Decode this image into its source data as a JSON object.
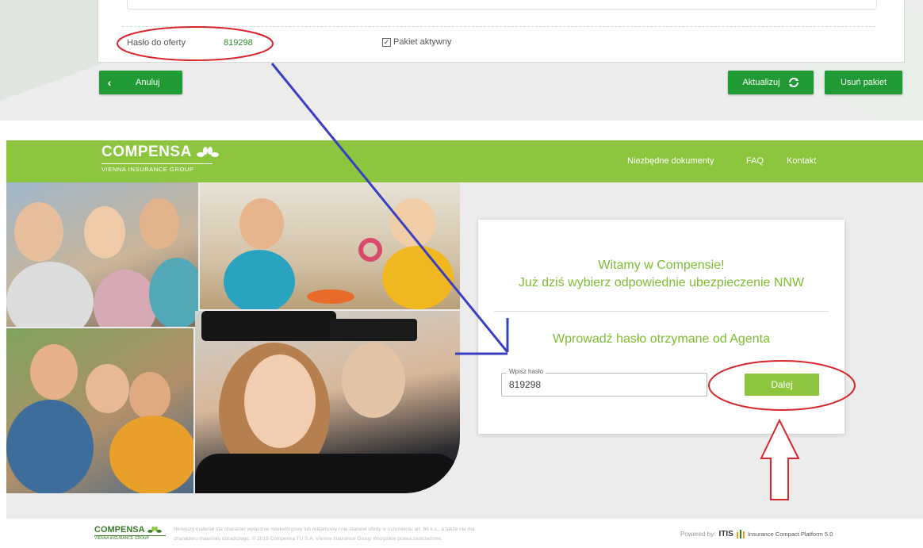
{
  "admin": {
    "password_label": "Hasło do oferty",
    "password_value": "819298",
    "package_active_label": "Pakiet aktywny",
    "package_active_checked": true,
    "cancel_label": "Anuluj",
    "update_label": "Aktualizuj",
    "delete_label": "Usuń pakiet"
  },
  "header": {
    "brand": "COMPENSA",
    "brand_sub": "VIENNA INSURANCE GROUP",
    "nav": [
      "Niezbędne dokumenty",
      "FAQ",
      "Kontakt"
    ]
  },
  "card": {
    "welcome_line1": "Witamy w Compensie!",
    "welcome_line2": "Już dziś wybierz odpowiednie ubezpieczenie NNW",
    "prompt": "Wprowadź hasło otrzymane od Agenta",
    "input_label": "Wpisz hasło",
    "input_value": "819298",
    "submit_label": "Dalej"
  },
  "footer": {
    "brand": "COMPENSA",
    "brand_sub": "VIENNA INSURANCE GROUP",
    "disclaimer_line1": "Niniejszy materiał ma charakter wyłącznie marketingowy lub reklamowy i nie stanowi oferty w rozumieniu art. 66 k.c., a także nie ma",
    "disclaimer_line2": "charakteru materiału doradczego. © 2019 Compensa TU S.A. Vienna Insurance Group Wszystkie prawa zastrzeżone.",
    "powered_by": "Powered by:",
    "itis": "ITIS",
    "platform": "Insurance Compact Platform 5.0"
  },
  "colors": {
    "brand_green": "#8cc63e",
    "button_green": "#1f9a35",
    "annotation_red": "#d8262c",
    "annotation_blue": "#3a3fc0"
  },
  "icons": {
    "cancel": "chevron-left-icon",
    "update": "refresh-icon",
    "brand": "compensa-flower-logo"
  }
}
